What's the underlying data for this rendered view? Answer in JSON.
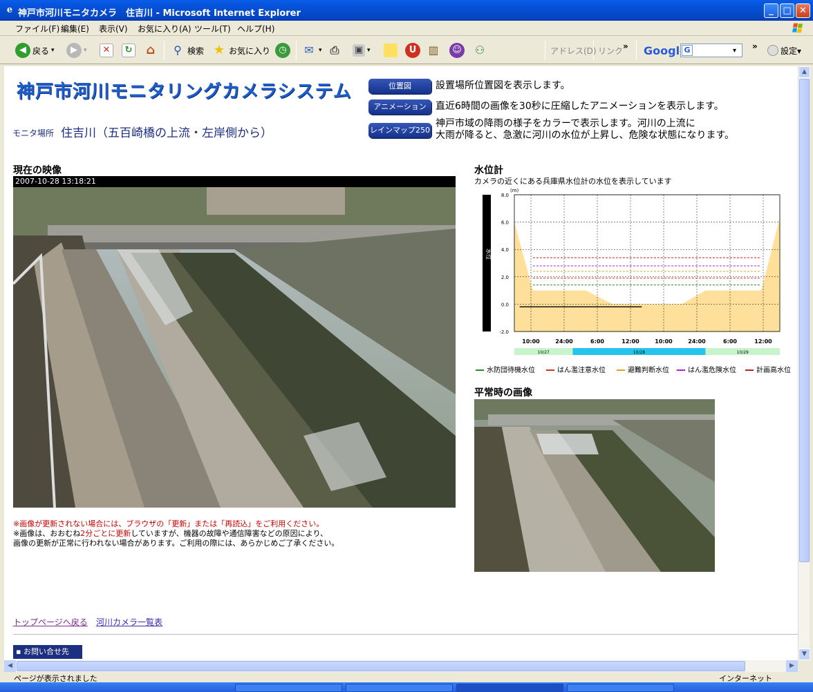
{
  "window": {
    "title": "神戸市河川モニタカメラ　住吉川 - Microsoft Internet Explorer",
    "controls": {
      "minimize": "_",
      "maximize": "□",
      "close": "✕"
    }
  },
  "menu": [
    "ファイル(F)",
    "編集(E)",
    "表示(V)",
    "お気に入り(A)",
    "ツール(T)",
    "ヘルプ(H)"
  ],
  "toolbar": {
    "back": "戻る",
    "search": "検索",
    "favorites": "お気に入り",
    "address": "アドレス(D)",
    "links": "リンク",
    "chevron": "»",
    "google": "Google",
    "settings": "設定▾"
  },
  "page": {
    "site_title": "神戸市河川モニタリングカメラシステム",
    "location_label": "モニタ場所",
    "location_value": "住吉川（五百崎橋の上流・左岸側から）",
    "nav": [
      {
        "label": "位置図",
        "desc": "設置場所位置図を表示します。"
      },
      {
        "label": "アニメーション",
        "desc": "直近6時間の画像を30秒に圧縮したアニメーションを表示します。"
      },
      {
        "label": "レインマップ250",
        "desc": "神戸市域の降雨の様子をカラーで表示します。河川の上流に",
        "desc2": "大雨が降ると、急激に河川の水位が上昇し、危険な状態になります。"
      }
    ],
    "current_title": "現在の映像",
    "timestamp": "2007-10-28 13:18:21",
    "normal_title": "平常時の画像",
    "notes": {
      "line1": "※画像が更新されない場合には、ブラウザの「更新」または「再読込」をご利用ください。",
      "line2a": "※画像は、おおむね",
      "line2b": "2分ごとに更新",
      "line2c": "していますが、機器の故障や通信障害などの原因により、",
      "line3": "画像の更新が正常に行われない場合があります。ご利用の際には、あらかじめご了承ください。"
    },
    "waterlevel_title": "水位計",
    "waterlevel_sub": "カメラの近くにある兵庫県水位計の水位を表示しています",
    "footer_links": [
      "トップページへ戻る",
      "河川カメラ一覧表"
    ],
    "contact": "お問い合せ先"
  },
  "status": {
    "text": "ページが表示されました",
    "zone": "インターネット"
  },
  "colors": {
    "nav_button": "#1f3d9e",
    "fill": "#ffe09a",
    "title_blue": "#1f5fcb",
    "date_band_a": "#c8f4cc",
    "date_band_b": "#25c4ec"
  },
  "chart_data": {
    "type": "area",
    "yunit": "(m)",
    "ylabel": "水位",
    "ylim": [
      -2.0,
      8.0
    ],
    "yticks": [
      "8.0",
      "6.0",
      "4.0",
      "2.0",
      "0.0",
      "-2.0"
    ],
    "xticks": [
      "10:00",
      "24:00",
      "6:00",
      "12:00",
      "10:00",
      "24:00",
      "6:00",
      "12:00"
    ],
    "date_bands": [
      "10/27",
      "10/28",
      "10/29"
    ],
    "thresholds": [
      {
        "name": "水防団待機水位",
        "value": 1.4,
        "color": "#2a8a2a"
      },
      {
        "name": "はん濫注意水位",
        "value": 1.9,
        "color": "#cc3322"
      },
      {
        "name": "避難判断水位",
        "value": 2.4,
        "color": "#e0a020"
      },
      {
        "name": "はん濫危険水位",
        "value": 2.8,
        "color": "#aa22cc"
      },
      {
        "name": "計画高水位",
        "value": 3.4,
        "color": "#bb2222"
      }
    ],
    "series": [
      {
        "name": "",
        "x": [
          0,
          0.07,
          0.27,
          0.37,
          0.63,
          0.72,
          0.93,
          1.0
        ],
        "values": [
          6.0,
          1.0,
          1.0,
          0.0,
          0.0,
          1.0,
          1.0,
          6.3
        ]
      }
    ],
    "observed": {
      "x": [
        0.02,
        0.48
      ],
      "values": [
        -0.2,
        -0.2
      ]
    }
  }
}
